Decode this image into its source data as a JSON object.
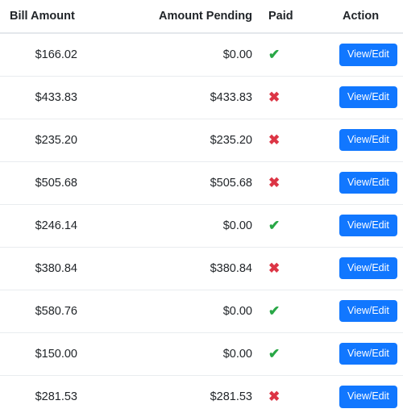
{
  "table": {
    "columns": [
      {
        "key": "bill_amount",
        "label": "Bill Amount"
      },
      {
        "key": "amount_pending",
        "label": "Amount Pending"
      },
      {
        "key": "paid",
        "label": "Paid"
      },
      {
        "key": "action",
        "label": "Action"
      }
    ],
    "action_label": "View/Edit",
    "icons": {
      "paid_yes": "check-icon",
      "paid_no": "cross-icon",
      "paid_yes_glyph": "✔",
      "paid_no_glyph": "✖"
    },
    "colors": {
      "button": "#1177ff",
      "button_text": "#ffffff",
      "check": "#28a745",
      "cross": "#dc3545",
      "text": "#212529",
      "row_border": "#e9ecef",
      "header_border": "#e4e7eb",
      "background": "#ffffff"
    },
    "rows": [
      {
        "bill_amount": "$166.02",
        "amount_pending": "$0.00",
        "paid": true,
        "action": "View/Edit"
      },
      {
        "bill_amount": "$433.83",
        "amount_pending": "$433.83",
        "paid": false,
        "action": "View/Edit"
      },
      {
        "bill_amount": "$235.20",
        "amount_pending": "$235.20",
        "paid": false,
        "action": "View/Edit"
      },
      {
        "bill_amount": "$505.68",
        "amount_pending": "$505.68",
        "paid": false,
        "action": "View/Edit"
      },
      {
        "bill_amount": "$246.14",
        "amount_pending": "$0.00",
        "paid": true,
        "action": "View/Edit"
      },
      {
        "bill_amount": "$380.84",
        "amount_pending": "$380.84",
        "paid": false,
        "action": "View/Edit"
      },
      {
        "bill_amount": "$580.76",
        "amount_pending": "$0.00",
        "paid": true,
        "action": "View/Edit"
      },
      {
        "bill_amount": "$150.00",
        "amount_pending": "$0.00",
        "paid": true,
        "action": "View/Edit"
      },
      {
        "bill_amount": "$281.53",
        "amount_pending": "$281.53",
        "paid": false,
        "action": "View/Edit"
      }
    ]
  }
}
